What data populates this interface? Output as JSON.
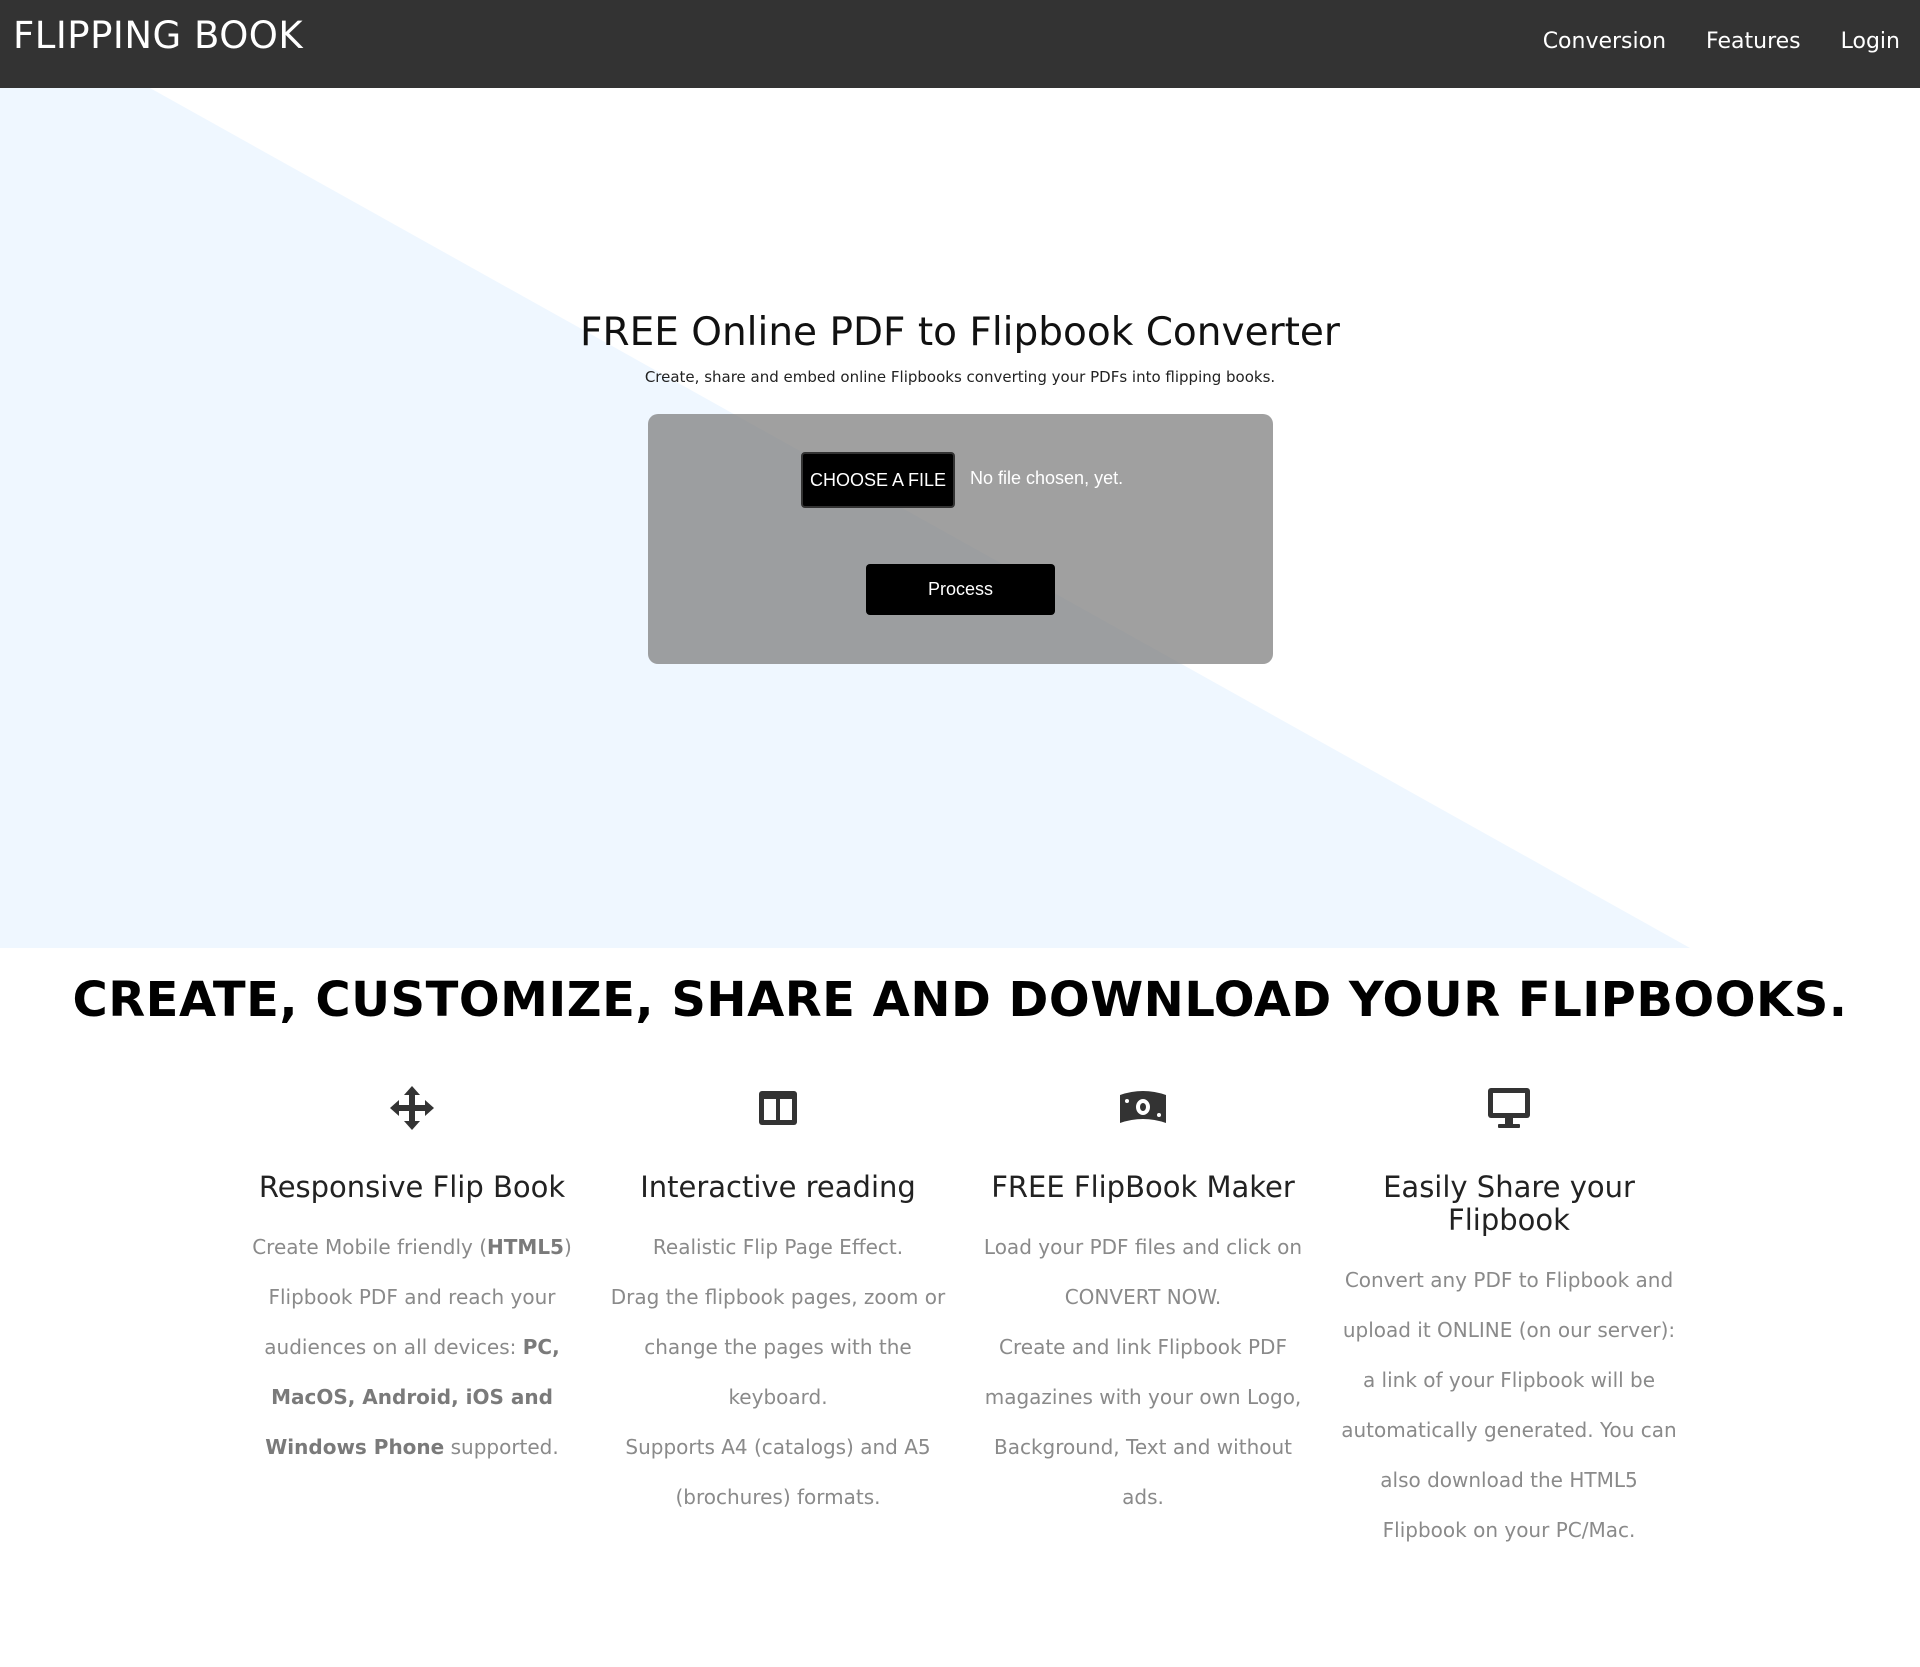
{
  "nav": {
    "brand": "FLIPPING BOOK",
    "links": [
      "Conversion",
      "Features",
      "Login"
    ]
  },
  "hero": {
    "title": "FREE Online PDF to Flipbook Converter",
    "subtitle": "Create, share and embed online Flipbooks converting your PDFs into flipping books.",
    "choose_label": "CHOOSE A FILE",
    "file_status": "No file chosen, yet.",
    "process_label": "Process"
  },
  "section": {
    "title": "CREATE, CUSTOMIZE, SHARE AND DOWNLOAD YOUR FLIPBOOKS."
  },
  "features": [
    {
      "icon": "move-arrows-icon",
      "title": "Responsive Flip Book",
      "text_parts": [
        "Create Mobile friendly (",
        "HTML5",
        ") Flipbook PDF and reach your audiences on all devices: ",
        "PC, MacOS, Android, iOS and Windows Phone",
        " supported."
      ]
    },
    {
      "icon": "columns-icon",
      "title": "Interactive reading",
      "lines": [
        "Realistic Flip Page Effect.",
        "Drag the flipbook pages, zoom or change the pages with the keyboard.",
        "Supports A4 (catalogs) and A5 (brochures) formats."
      ]
    },
    {
      "icon": "money-bill-icon",
      "title": "FREE FlipBook Maker",
      "lines": [
        "Load your PDF files and click on CONVERT NOW.",
        "Create and link Flipbook PDF magazines with your own Logo, Background, Text and without ads."
      ]
    },
    {
      "icon": "desktop-monitor-icon",
      "title": "Easily Share your Flipbook",
      "text": "Convert any PDF to Flipbook and upload it ONLINE (on our server): a link of your Flipbook will be automatically generated. You can also download the HTML5 Flipbook on your PC/Mac."
    }
  ],
  "colors": {
    "navbar": "#333333",
    "hero_triangle": "#eff7ff",
    "upload_box": "#9a9a9a",
    "button": "#000000",
    "feature_text": "#8a8a8a"
  }
}
